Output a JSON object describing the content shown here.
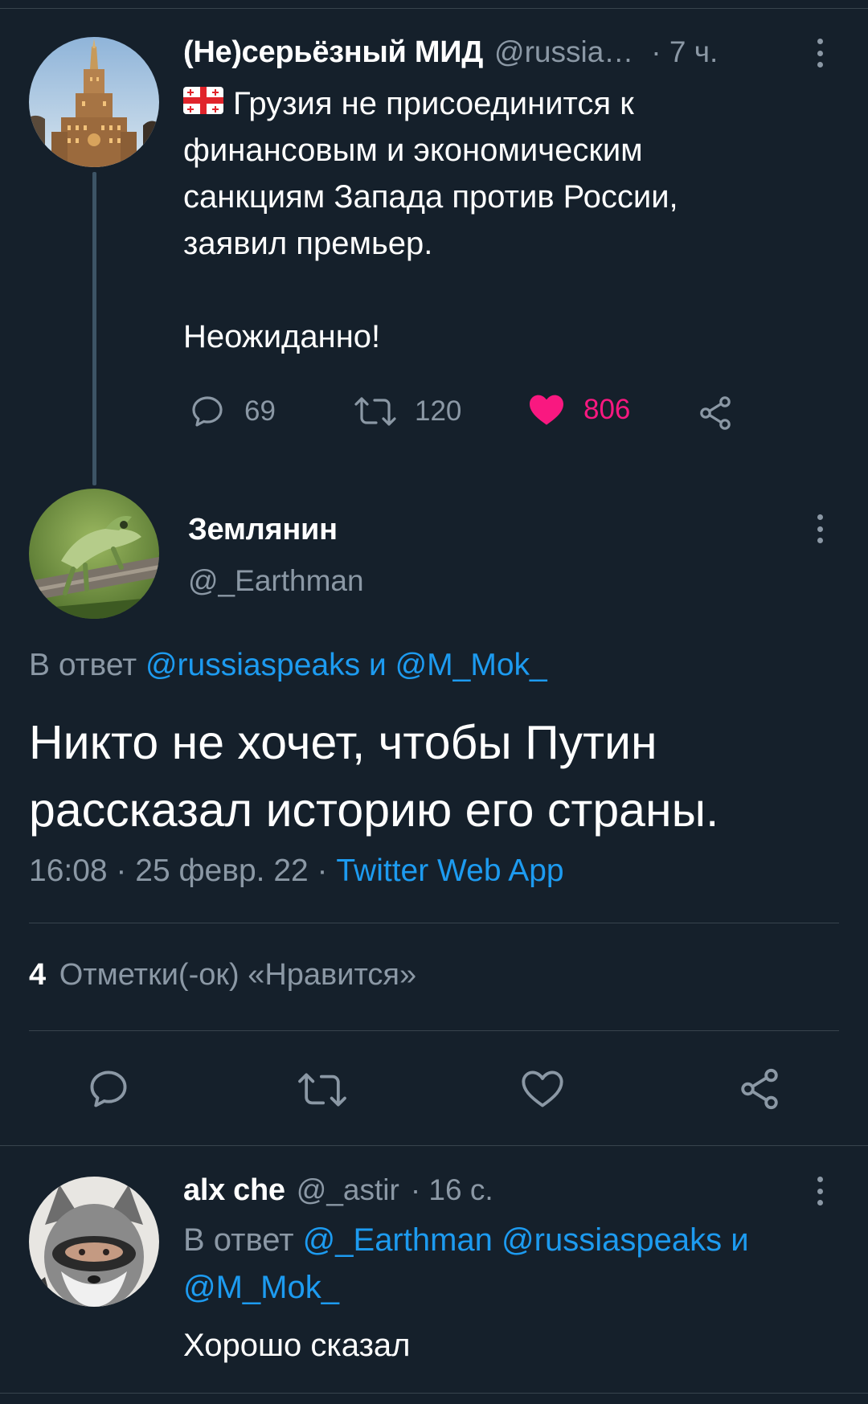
{
  "tweet1": {
    "name": "(Не)серьёзный МИД",
    "handle": "@russia…",
    "time": "· 7 ч.",
    "text_line1": "Грузия не присоединится к",
    "text_line2": "финансовым и экономическим",
    "text_line3": "санкциям Запада против России,",
    "text_line4": "заявил премьер.",
    "text_line5": "Неожиданно!",
    "flag_icon": "georgia-flag-emoji",
    "replies": "69",
    "retweets": "120",
    "likes": "806",
    "like_color": "#f91880"
  },
  "main_tweet": {
    "name": "Землянин",
    "handle": "@_Earthman",
    "reply_prefix": "В ответ",
    "reply_to": "@russiaspeaks и @M_Mok_",
    "text_line1": "Никто не хочет, чтобы Путин",
    "text_line2": "рассказал историю его страны.",
    "meta": "16:08 · 25 февр. 22 ·",
    "source": "Twitter Web App",
    "likes_count": "4",
    "likes_label": "Отметки(-ок) «Нравится»"
  },
  "reply_tweet": {
    "name": "alx che",
    "handle": "@_astir",
    "time": "· 16 с.",
    "reply_prefix": "В ответ",
    "reply_to_line1": "@_Earthman @russiaspeaks и",
    "reply_to_line2": "@M_Mok_",
    "text": "Хорошо сказал"
  },
  "colors": {
    "background": "#15202b",
    "accent": "#1d9bf0",
    "muted": "#8b98a5",
    "like": "#f91880"
  }
}
